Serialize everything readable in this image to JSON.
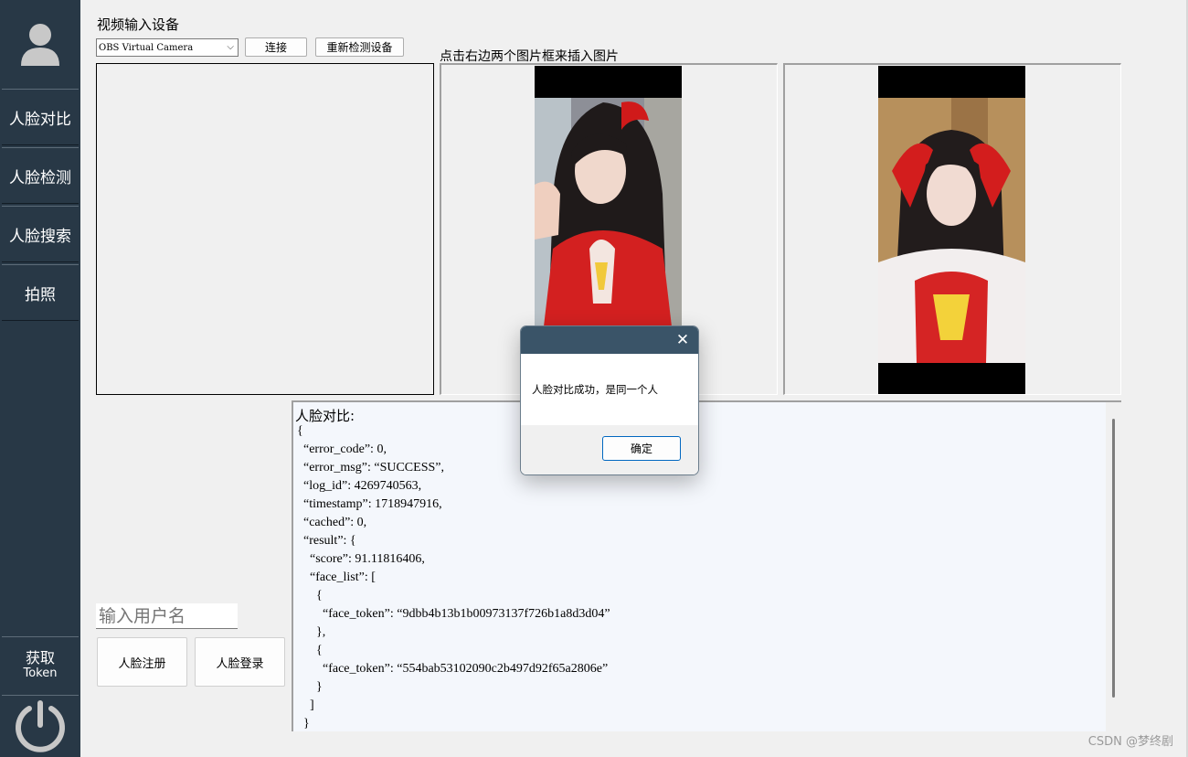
{
  "sidebar": {
    "nav": [
      {
        "label": "人脸对比"
      },
      {
        "label": "人脸检测"
      },
      {
        "label": "人脸搜索"
      },
      {
        "label": "拍照"
      }
    ],
    "token_line1": "获取",
    "token_line2": "Token"
  },
  "top": {
    "device_label": "视频输入设备",
    "device_selected": "OBS Virtual Camera",
    "connect_label": "连接",
    "redetect_label": "重新检测设备",
    "hint": "点击右边两个图片框来插入图片"
  },
  "output": {
    "title": "人脸对比:",
    "text": "{\n  “error_code”: 0,\n  “error_msg”: “SUCCESS”,\n  “log_id”: 4269740563,\n  “timestamp”: 1718947916,\n  “cached”: 0,\n  “result”: {\n    “score”: 91.11816406,\n    “face_list”: [\n      {\n        “face_token”: “9dbb4b13b1b00973137f726b1a8d3d04”\n      },\n      {\n        “face_token”: “554bab53102090c2b497d92f65a2806e”\n      }\n    ]\n  }"
  },
  "user": {
    "username_placeholder": "输入用户名",
    "register_label": "人脸注册",
    "login_label": "人脸登录"
  },
  "dialog": {
    "message": "人脸对比成功，是同一个人",
    "ok_label": "确定",
    "close_glyph": "✕"
  },
  "watermark": "CSDN @梦终剧",
  "colors": {
    "sidebar": "#283846",
    "dialog_titlebar": "#3a5468",
    "dialog_ok_border": "#0067c0",
    "output_bg": "#f4f7fc"
  },
  "icons": {
    "avatar": "user-avatar-icon",
    "power": "power-icon",
    "dropdown": "chevron-down-icon",
    "close": "close-icon"
  }
}
